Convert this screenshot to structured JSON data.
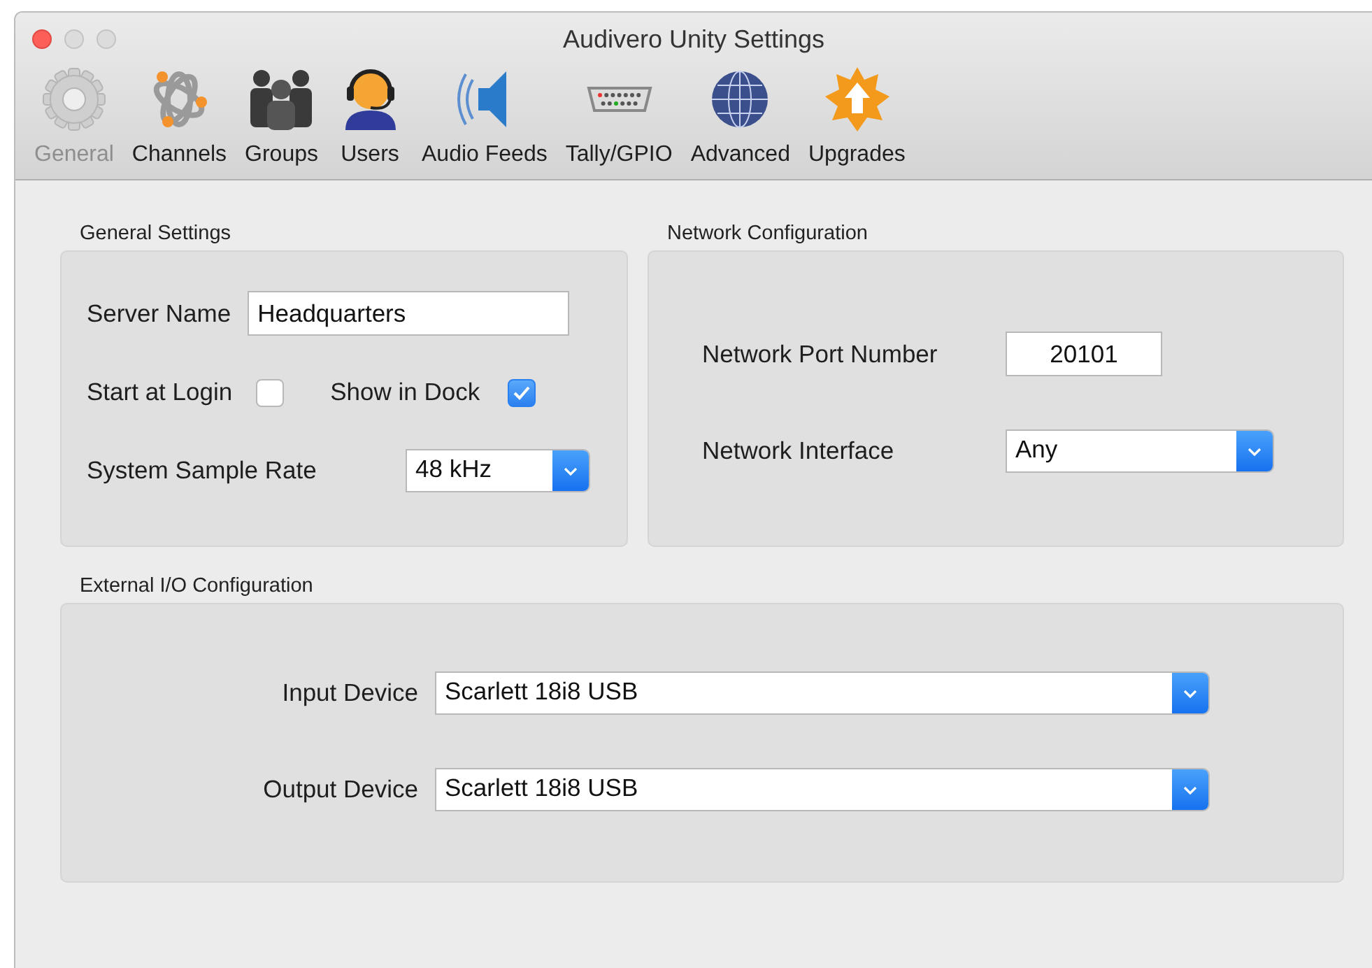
{
  "window": {
    "title": "Audivero Unity Settings"
  },
  "toolbar": [
    {
      "label": "General",
      "kind": "gear",
      "selected": true
    },
    {
      "label": "Channels",
      "kind": "channels",
      "selected": false
    },
    {
      "label": "Groups",
      "kind": "groups",
      "selected": false
    },
    {
      "label": "Users",
      "kind": "user",
      "selected": false
    },
    {
      "label": "Audio Feeds",
      "kind": "speaker",
      "selected": false
    },
    {
      "label": "Tally/GPIO",
      "kind": "connector",
      "selected": false
    },
    {
      "label": "Advanced",
      "kind": "globe",
      "selected": false
    },
    {
      "label": "Upgrades",
      "kind": "upgrade",
      "selected": false
    }
  ],
  "general_settings": {
    "title": "General Settings",
    "server_name": {
      "label": "Server Name",
      "value": "Headquarters"
    },
    "start_at_login": {
      "label": "Start at Login",
      "checked": false
    },
    "show_in_dock": {
      "label": "Show in Dock",
      "checked": true
    },
    "sample_rate": {
      "label": "System Sample Rate",
      "value": "48 kHz"
    }
  },
  "network_configuration": {
    "title": "Network Configuration",
    "port": {
      "label": "Network Port Number",
      "value": "20101"
    },
    "interface": {
      "label": "Network Interface",
      "value": "Any"
    }
  },
  "external_io": {
    "title": "External I/O Configuration",
    "input_device": {
      "label": "Input Device",
      "value": "Scarlett 18i8 USB"
    },
    "output_device": {
      "label": "Output Device",
      "value": "Scarlett 18i8 USB"
    }
  }
}
